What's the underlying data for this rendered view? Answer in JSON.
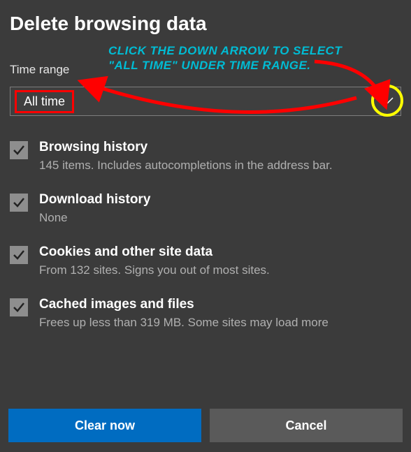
{
  "title": "Delete browsing data",
  "time_range": {
    "label": "Time range",
    "value": "All time"
  },
  "items": [
    {
      "title": "Browsing history",
      "desc": "145 items. Includes autocompletions in the address bar.",
      "checked": true
    },
    {
      "title": "Download history",
      "desc": "None",
      "checked": true
    },
    {
      "title": "Cookies and other site data",
      "desc": "From 132 sites. Signs you out of most sites.",
      "checked": true
    },
    {
      "title": "Cached images and files",
      "desc": "Frees up less than 319 MB. Some sites may load more",
      "checked": true
    }
  ],
  "buttons": {
    "primary": "Clear now",
    "secondary": "Cancel"
  },
  "annotation": {
    "line1": "Click the down arrow to select",
    "line2": "\"All Time\" under Time Range."
  },
  "colors": {
    "annotation": "#00bcd4",
    "highlight_border": "#ff0000",
    "circle": "#ffff00",
    "primary_btn": "#006cc1"
  }
}
